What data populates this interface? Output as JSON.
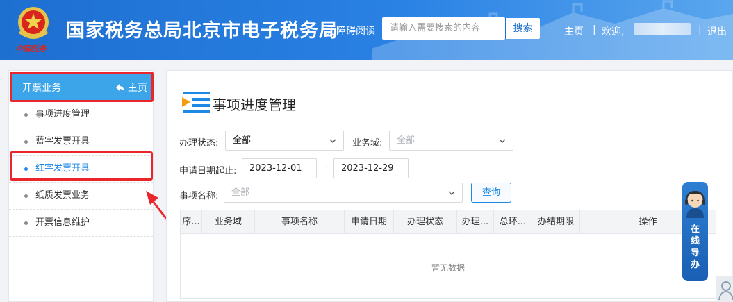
{
  "header": {
    "emblem_text": "中国税务",
    "site_title": "国家税务总局北京市电子税务局",
    "accessibility_label": "无障碍阅读",
    "search_placeholder": "请输入需要搜索的内容",
    "search_button": "搜索",
    "home_link": "主页",
    "separator": "|",
    "welcome": "欢迎,",
    "logout": "退出"
  },
  "sidebar": {
    "title": "开票业务",
    "home_label": "主页",
    "items": [
      {
        "label": "事项进度管理"
      },
      {
        "label": "蓝字发票开具"
      },
      {
        "label": "红字发票开具"
      },
      {
        "label": "纸质发票业务"
      },
      {
        "label": "开票信息维护"
      }
    ]
  },
  "main": {
    "title": "事项进度管理",
    "status_label": "办理状态:",
    "status_value": "全部",
    "domain_label": "业务域:",
    "domain_value": "全部",
    "date_label": "申请日期起止:",
    "date_start": "2023-12-01",
    "date_sep": "-",
    "date_end": "2023-12-29",
    "item_label": "事项名称:",
    "item_value": "全部",
    "query_button": "查询",
    "table_headers": [
      "序...",
      "业务域",
      "事项名称",
      "申请日期",
      "办理状态",
      "办理...",
      "总环...",
      "办结期限",
      "操作"
    ],
    "empty_text": "暂无数据"
  },
  "guide": {
    "text": "在线导办"
  },
  "colors": {
    "header_blue": "#1d6fd0",
    "sidebar_active": "#3ca5ea",
    "highlight_red": "#e9262b",
    "link_blue": "#1e88e5"
  }
}
